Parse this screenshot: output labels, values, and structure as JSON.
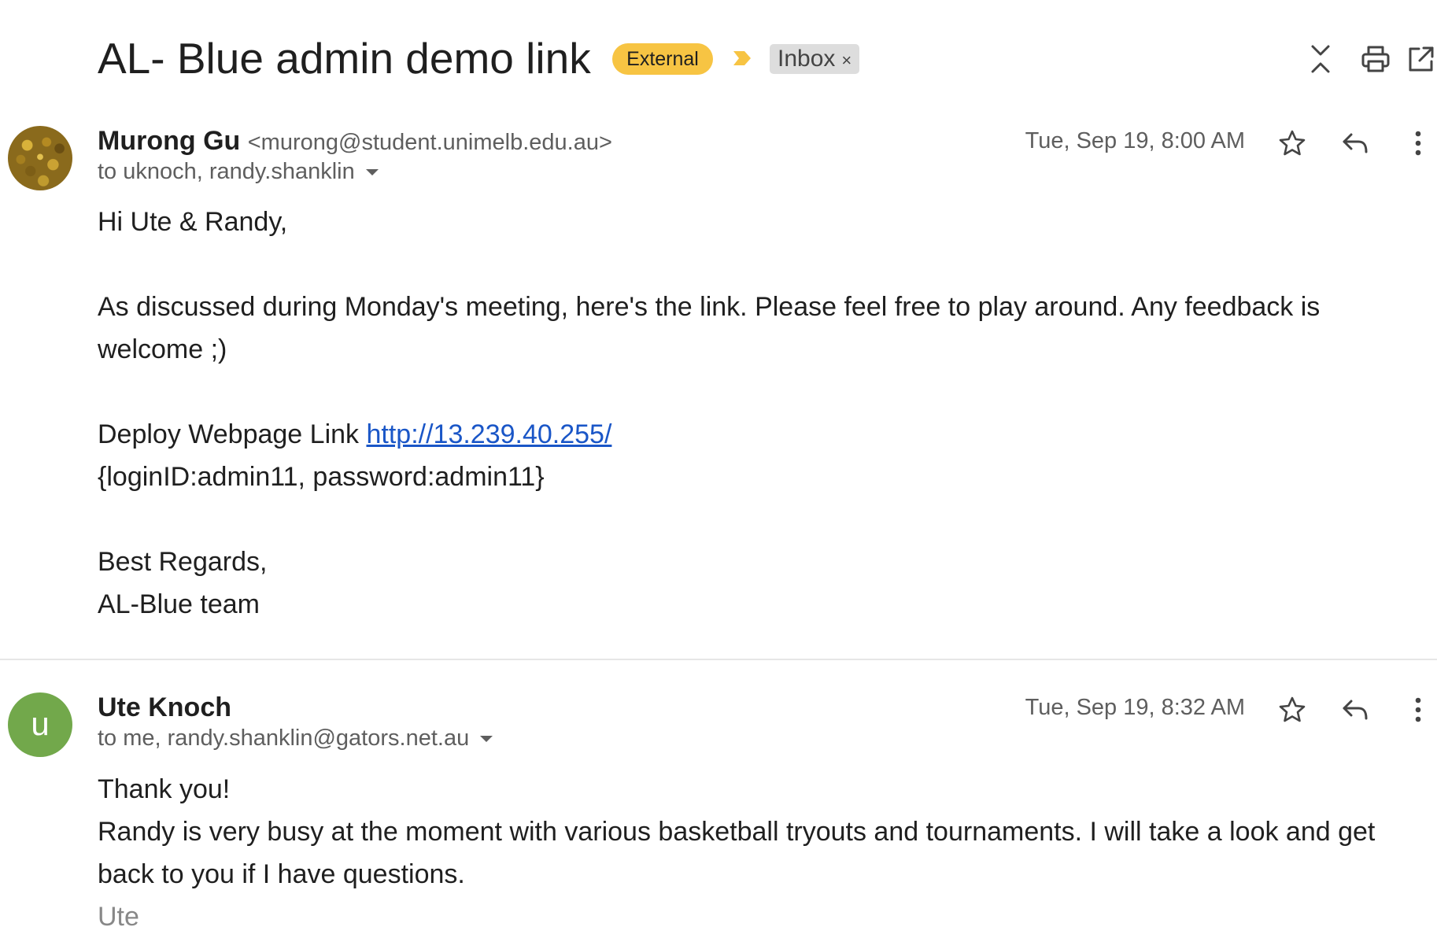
{
  "thread": {
    "subject": "AL- Blue admin demo link",
    "labels": {
      "external": "External",
      "inbox": "Inbox",
      "remove": "×"
    },
    "header_icons": [
      "collapse-icon",
      "print-icon",
      "open-in-new-window-icon"
    ]
  },
  "messages": [
    {
      "sender_name": "Murong Gu",
      "sender_email": "<murong@student.unimelb.edu.au>",
      "recipients": "to uknoch, randy.shanklin",
      "date": "Tue, Sep 19, 8:00 AM",
      "avatar": {
        "type": "photo"
      },
      "body": {
        "greeting": "Hi Ute & Randy,",
        "para1": "As discussed during Monday's meeting, here's the link. Please feel free to play around. Any feedback is welcome ;)",
        "link_prefix": "Deploy Webpage Link ",
        "link": "http://13.239.40.255/",
        "credentials": "{loginID:admin11, password:admin11}",
        "closing": "Best Regards,",
        "team": "AL-Blue team"
      }
    },
    {
      "sender_name": "Ute Knoch",
      "recipients": "to me, randy.shanklin@gators.net.au",
      "date": "Tue, Sep 19, 8:32 AM",
      "avatar": {
        "type": "letter",
        "letter": "u",
        "color": "#72a84b"
      },
      "body": {
        "line1": "Thank you!",
        "para1": "Randy is very busy at the moment with various basketball tryouts and tournaments. I will take a look and get back to you if I have questions.",
        "signature": "Ute"
      }
    }
  ],
  "colors": {
    "external_badge": "#f7c443",
    "link": "#1a56c7",
    "avatar_green": "#72a84b"
  }
}
